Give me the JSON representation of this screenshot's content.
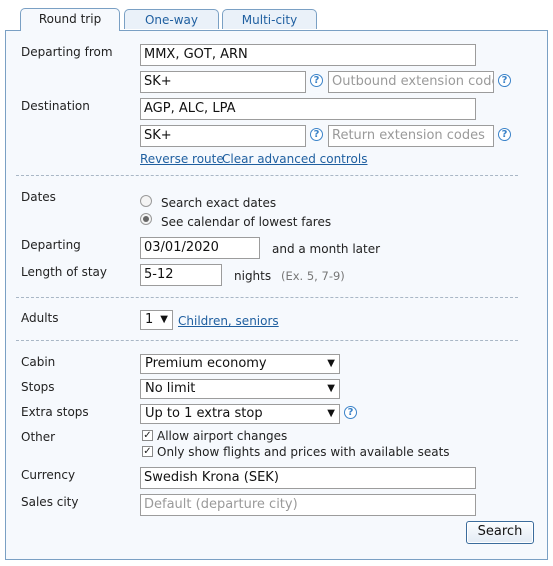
{
  "tabs": [
    {
      "label": "Round trip",
      "active": true
    },
    {
      "label": "One-way",
      "active": false
    },
    {
      "label": "Multi-city",
      "active": false
    }
  ],
  "form": {
    "departing_from": {
      "label": "Departing from",
      "value": "MMX, GOT, ARN"
    },
    "outbound_routing": {
      "value": "SK+"
    },
    "outbound_extension": {
      "placeholder": "Outbound extension codes"
    },
    "destination": {
      "label": "Destination",
      "value": "AGP, ALC, LPA"
    },
    "return_routing": {
      "value": "SK+"
    },
    "return_extension": {
      "placeholder": "Return extension codes"
    },
    "links": {
      "reverse": "Reverse route",
      "clear": "Clear advanced controls"
    },
    "help_icon": "?",
    "dates": {
      "label": "Dates",
      "option_exact": "Search exact dates",
      "option_calendar": "See calendar of lowest fares",
      "selected": "calendar"
    },
    "departing": {
      "label": "Departing",
      "value": "03/01/2020",
      "suffix": "and a month later"
    },
    "length_of_stay": {
      "label": "Length of stay",
      "value": "5-12",
      "unit": "nights",
      "hint": "(Ex. 5, 7-9)"
    },
    "adults": {
      "label": "Adults",
      "value": "1",
      "link": "Children, seniors"
    },
    "cabin": {
      "label": "Cabin",
      "value": "Premium economy"
    },
    "stops": {
      "label": "Stops",
      "value": "No limit"
    },
    "extra_stops": {
      "label": "Extra stops",
      "value": "Up to 1 extra stop"
    },
    "other": {
      "label": "Other",
      "allow_airport_changes": {
        "label": "Allow airport changes",
        "checked": true
      },
      "available_seats": {
        "label": "Only show flights and prices with available seats",
        "checked": true
      }
    },
    "currency": {
      "label": "Currency",
      "value": "Swedish Krona (SEK)"
    },
    "sales_city": {
      "label": "Sales city",
      "placeholder": "Default (departure city)"
    },
    "search_button": "Search"
  },
  "icons": {
    "help": "help-circle-icon",
    "dropdown": "chevron-down-icon",
    "check": "checkmark-icon"
  },
  "colors": {
    "border": "#7aa0c4",
    "link": "#1f5fa0",
    "panel_bg": "#f6f9fd",
    "help": "#3b83c9"
  }
}
